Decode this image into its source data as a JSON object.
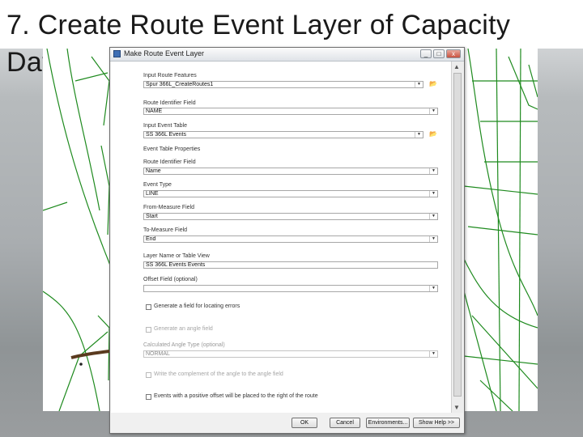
{
  "slide": {
    "title": "7. Create Route Event Layer of Capacity Data"
  },
  "dialog": {
    "title": "Make Route Event Layer",
    "window_buttons": [
      "_",
      "□",
      "x"
    ],
    "fields": {
      "input_route_features": {
        "label": "Input Route Features",
        "value": "Spur 366L_CreateRoutes1"
      },
      "route_identifier_field": {
        "label": "Route Identifier Field",
        "value": "NAME"
      },
      "input_event_table": {
        "label": "Input Event Table",
        "value": "SS 366L Events"
      },
      "event_table_properties": {
        "label": "Event Table Properties"
      },
      "event_route_identifier_field": {
        "label": "Route Identifier Field",
        "value": "Name"
      },
      "event_type": {
        "label": "Event Type",
        "value": "LINE"
      },
      "from_measure_field": {
        "label": "From-Measure Field",
        "value": "Start"
      },
      "to_measure_field": {
        "label": "To-Measure Field",
        "value": "End"
      },
      "layer_name": {
        "label": "Layer Name or Table View",
        "value": "SS 366L Events Events"
      },
      "offset_field": {
        "label": "Offset Field (optional)",
        "value": ""
      },
      "generate_error_field": {
        "label": "Generate a field for locating errors"
      },
      "angle_field": {
        "label": "Generate an angle field"
      },
      "calculated_angle_type": {
        "label": "Calculated Angle Type (optional)",
        "value": "NORMAL"
      },
      "write_complement": {
        "label": "Write the complement of the angle to the angle field"
      },
      "positive_offset": {
        "label": "Events with a positive offset will be placed to the right of the route"
      }
    },
    "buttons": {
      "ok": "OK",
      "cancel": "Cancel",
      "environments": "Environments...",
      "show_help": "Show Help >>"
    }
  },
  "colors": {
    "map_line": "#1e8a1e",
    "map_highlight": "#5a3a1e",
    "accent": "#3f6fb5"
  }
}
